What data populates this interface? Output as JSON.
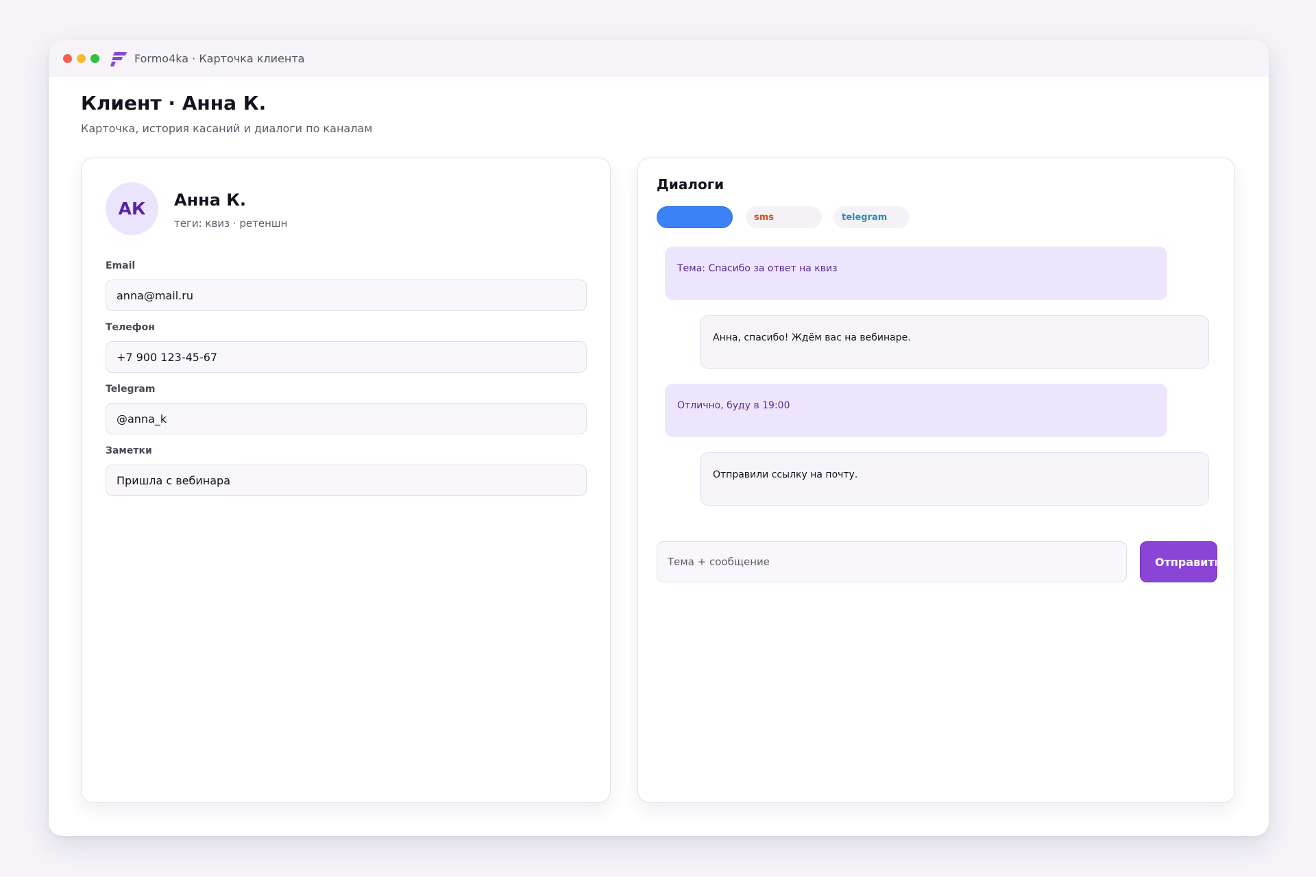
{
  "window": {
    "title": "Formo4ka · Карточка клиента"
  },
  "page": {
    "title": "Клиент · Анна К.",
    "subtitle": "Карточка, история касаний и диалоги по каналам"
  },
  "client": {
    "initials": "АК",
    "name": "Анна К.",
    "tags": "теги: квиз · ретеншн",
    "fields": [
      {
        "label": "Email",
        "value": "anna@mail.ru"
      },
      {
        "label": "Телефон",
        "value": "+7 900 123-45-67"
      },
      {
        "label": "Telegram",
        "value": "@anna_k"
      },
      {
        "label": "Заметки",
        "value": "Пришла с вебинара"
      }
    ]
  },
  "dialogs": {
    "title": "Диалоги",
    "channels": [
      {
        "label": "",
        "active": true
      },
      {
        "label": "sms",
        "active": false
      },
      {
        "label": "telegram",
        "active": false
      }
    ],
    "messages": [
      {
        "direction": "in",
        "text": "Тема: Спасибо за ответ на квиз"
      },
      {
        "direction": "out",
        "text": "Анна, спасибо! Ждём вас на вебинаре."
      },
      {
        "direction": "in",
        "text": "Отлично, буду в 19:00"
      },
      {
        "direction": "out",
        "text": "Отправили ссылку на почту."
      }
    ],
    "compose": {
      "placeholder": "Тема + сообщение",
      "send_label": "Отправить"
    }
  },
  "colors": {
    "accent": "#8a45d6",
    "active_channel": "#3b82f6",
    "sms": "#d4531c",
    "telegram": "#2b8fb6",
    "incoming_bubble": "#ede5fd",
    "outgoing_bubble": "#f6f4f9"
  },
  "icons": [
    "window-close-dot",
    "window-minimize-dot",
    "window-maximize-dot",
    "app-logo-icon"
  ]
}
